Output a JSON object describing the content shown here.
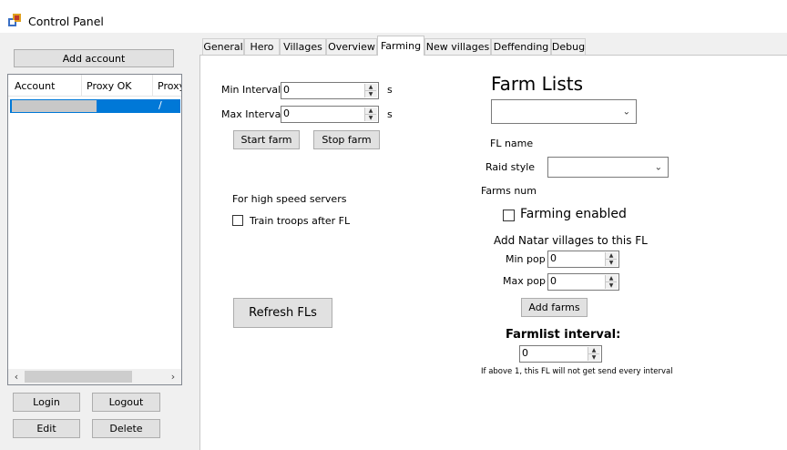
{
  "window": {
    "title": "Control Panel"
  },
  "sidebar": {
    "add_account_label": "Add account",
    "table": {
      "columns": [
        "Account",
        "Proxy OK",
        "Proxy"
      ],
      "rows": [
        {
          "account": "",
          "proxy_ok": "",
          "proxy": "/"
        }
      ]
    },
    "login_label": "Login",
    "logout_label": "Logout",
    "edit_label": "Edit",
    "delete_label": "Delete"
  },
  "tabs": [
    "General",
    "Hero",
    "Villages",
    "Overview",
    "Farming",
    "New villages",
    "Deffending",
    "Debug"
  ],
  "active_tab": "Farming",
  "farming": {
    "min_interval_label": "Min Interval",
    "min_interval_value": "0",
    "max_interval_label": "Max Interval",
    "max_interval_value": "0",
    "unit": "s",
    "start_farm_label": "Start farm",
    "stop_farm_label": "Stop farm",
    "high_speed_label": "For high speed servers",
    "train_troops_label": "Train troops after FL",
    "refresh_fls_label": "Refresh FLs",
    "farm_lists_title": "Farm Lists",
    "fl_name_label": "FL name",
    "raid_style_label": "Raid style",
    "farms_num_label": "Farms num",
    "farming_enabled_label": "Farming enabled",
    "add_natar_label": "Add Natar villages to this FL",
    "min_pop_label": "Min pop",
    "min_pop_value": "0",
    "max_pop_label": "Max pop",
    "max_pop_value": "0",
    "add_farms_label": "Add farms",
    "farmlist_interval_label": "Farmlist interval:",
    "farmlist_interval_value": "0",
    "interval_note": "If above 1, this FL will not get send every interval"
  }
}
